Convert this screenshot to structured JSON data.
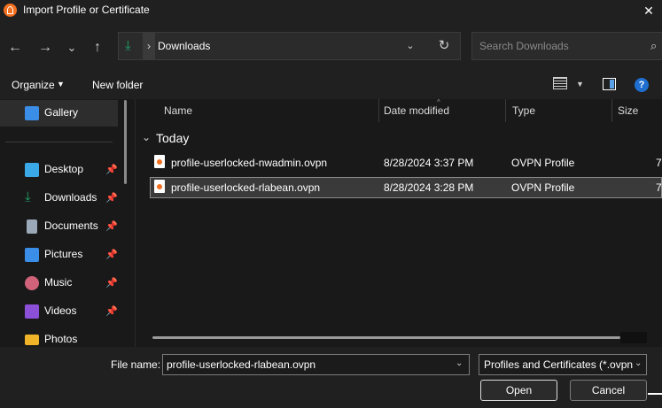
{
  "window": {
    "title": "Import Profile or Certificate",
    "close_glyph": "✕"
  },
  "nav": {
    "back_glyph": "←",
    "forward_glyph": "→",
    "recent_glyph": "⌄",
    "up_glyph": "↑",
    "address": "Downloads",
    "address_chevron": "›",
    "address_dropdown_glyph": "⌄",
    "refresh_glyph": "↻",
    "search_placeholder": "Search Downloads",
    "search_glyph": "⌕"
  },
  "toolbar": {
    "organize_label": "Organize",
    "organize_caret": "▼",
    "new_folder_label": "New folder",
    "view_caret": "▼",
    "help_glyph": "?"
  },
  "sidebar": {
    "items": [
      {
        "label": "Gallery",
        "icon": "gallery-icon",
        "color": "#3b8ee8"
      },
      {
        "label": "Desktop",
        "icon": "desktop-icon",
        "color": "#3ba8e8",
        "pin": "📌"
      },
      {
        "label": "Downloads",
        "icon": "download-icon",
        "color": "#21a366",
        "pin": "📌"
      },
      {
        "label": "Documents",
        "icon": "documents-icon",
        "color": "#9aa8b8",
        "pin": "📌"
      },
      {
        "label": "Pictures",
        "icon": "pictures-icon",
        "color": "#3b8ee8",
        "pin": "📌"
      },
      {
        "label": "Music",
        "icon": "music-icon",
        "color": "#d0637a",
        "pin": "📌"
      },
      {
        "label": "Videos",
        "icon": "videos-icon",
        "color": "#8c4fd8",
        "pin": "📌"
      },
      {
        "label": "Photos",
        "icon": "photos-icon",
        "color": "#f0b429"
      }
    ]
  },
  "file_list": {
    "columns": [
      "Name",
      "Date modified",
      "Type",
      "Size"
    ],
    "sort_glyph": "^",
    "group_chevron": "⌄",
    "group": "Today",
    "rows": [
      {
        "name": "profile-userlocked-nwadmin.ovpn",
        "date": "8/28/2024 3:37 PM",
        "type": "OVPN Profile",
        "size": "7"
      },
      {
        "name": "profile-userlocked-rlabean.ovpn",
        "date": "8/28/2024 3:28 PM",
        "type": "OVPN Profile",
        "size": "7",
        "selected": true
      }
    ]
  },
  "footer": {
    "file_name_label": "File name:",
    "file_name_value": "profile-userlocked-rlabean.ovpn",
    "dropdown_glyph": "⌄",
    "filter_value": "Profiles and Certificates (*.ovpn",
    "open_label": "Open",
    "cancel_label": "Cancel"
  },
  "colors": {
    "background": "#191919",
    "chrome": "#202020",
    "selection": "#3a3a3a",
    "accent": "#1f6fd1",
    "openvpn_orange": "#f37021"
  }
}
